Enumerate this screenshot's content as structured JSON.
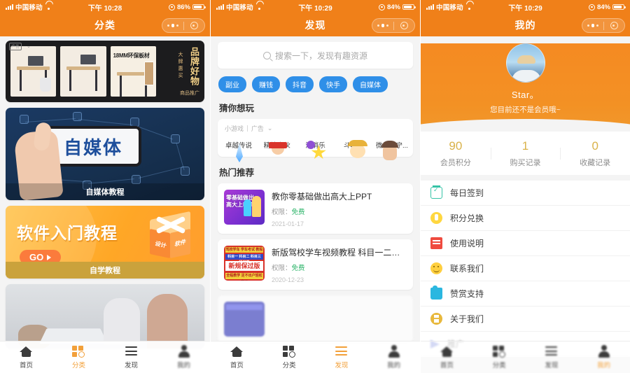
{
  "status_bar": {
    "carrier": "中国移动",
    "time_1": "下午 10:28",
    "time_2": "下午 10:29",
    "time_3": "下午 10:29",
    "battery_1": "86%",
    "battery_2": "84%",
    "battery_3": "84%"
  },
  "panel1": {
    "title": "分类",
    "cards": [
      {
        "name": "ad-banner",
        "badge": "广告",
        "headline": "品牌好物",
        "sub": "大牌惠买",
        "footer": "商品推广",
        "thumb3_text": "18MM环保板材",
        "thumb3_num": "18"
      },
      {
        "name": "self-media",
        "hero": "自媒体",
        "label": "自媒体教程"
      },
      {
        "name": "software",
        "hero": "软件入门教程",
        "cta": "GO",
        "label": "自学教程",
        "box_left": "设计",
        "box_right": "软件"
      },
      {
        "name": "office-photo"
      }
    ],
    "tabs": [
      {
        "label": "首页",
        "icon": "home-icon",
        "active": false
      },
      {
        "label": "分类",
        "icon": "grid-search-icon",
        "active": true
      },
      {
        "label": "发现",
        "icon": "list-icon",
        "active": false
      },
      {
        "label": "我的",
        "icon": "user-icon",
        "active": false
      }
    ]
  },
  "panel2": {
    "title": "发现",
    "search": {
      "placeholder": "搜索一下，发现有趣资源",
      "value": "",
      "icon": "search-icon"
    },
    "tags": [
      "副业",
      "赚钱",
      "抖音",
      "快手",
      "自媒体"
    ],
    "games_section": {
      "title": "猜你想玩",
      "source": "小游戏",
      "ad_label": "广告",
      "chevron": "⌄"
    },
    "games": [
      {
        "name": "卓越传说"
      },
      {
        "name": "精神小伙"
      },
      {
        "name": "消消乐"
      },
      {
        "name": "斗地主"
      },
      {
        "name": "微乐辽宁..."
      }
    ],
    "hot_section_title": "热门推荐",
    "hot_items": [
      {
        "title": "教你零基础做出高大上PPT",
        "perm_label": "权限：",
        "perm_value": "免费",
        "date": "2021-01-17",
        "thumb_text": "零基础做出\n高大上PPT"
      },
      {
        "title": "新版驾校学车视频教程 科目一二三四...",
        "perm_label": "权限：",
        "perm_value": "免费",
        "date": "2020-12-23",
        "thumb_r1": "驾校学车 学车考试 教程",
        "thumb_r2": "科目一 科目二 科目三 科目四",
        "thumb_r3": "新规保过版",
        "thumb_r4": "全程教学 足不出户轻松拿证"
      }
    ],
    "tabs": [
      {
        "label": "首页",
        "icon": "home-icon",
        "active": false
      },
      {
        "label": "分类",
        "icon": "grid-search-icon",
        "active": false
      },
      {
        "label": "发现",
        "icon": "list-icon",
        "active": true
      },
      {
        "label": "我的",
        "icon": "user-icon",
        "active": false
      }
    ]
  },
  "panel3": {
    "title": "我的",
    "profile": {
      "username": "Star。",
      "subtitle": "您目前还不是会员哦~",
      "avatar": "avatar"
    },
    "stats": [
      {
        "value": "90",
        "label": "会员积分"
      },
      {
        "value": "1",
        "label": "购买记录"
      },
      {
        "value": "0",
        "label": "收藏记录"
      }
    ],
    "menu": [
      {
        "label": "每日签到",
        "icon": "calendar-check-icon"
      },
      {
        "label": "积分兑换",
        "icon": "coin-icon"
      },
      {
        "label": "使用说明",
        "icon": "book-icon"
      },
      {
        "label": "联系我们",
        "icon": "smiley-icon"
      },
      {
        "label": "赞赏支持",
        "icon": "thumbs-up-icon"
      },
      {
        "label": "关于我们",
        "icon": "info-icon"
      },
      {
        "label": "推广",
        "icon": "send-icon"
      }
    ]
  },
  "colors": {
    "brand_orange": "#f08019",
    "tag_blue": "#2f8fe8",
    "active_tab": "#f2a03a",
    "free_green": "#2fb56b",
    "points_gold": "#d9b24a"
  }
}
